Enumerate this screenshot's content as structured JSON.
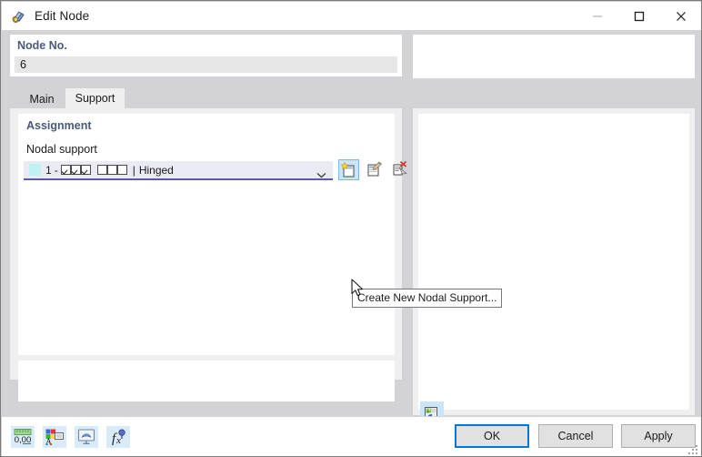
{
  "window": {
    "title": "Edit Node",
    "icon": "node-icon",
    "controls": {
      "minimize": "minimize-icon",
      "maximize": "maximize-icon",
      "close": "close-icon"
    }
  },
  "node_no": {
    "label": "Node No.",
    "value": "6",
    "placeholder": ""
  },
  "tabs": [
    {
      "id": "main",
      "label": "Main",
      "active": false
    },
    {
      "id": "support",
      "label": "Support",
      "active": true
    }
  ],
  "assignment": {
    "title": "Assignment",
    "field_label": "Nodal support",
    "combo": {
      "swatch_color": "#bff3f3",
      "number": "1",
      "separator": "-",
      "checks_on": 3,
      "checks_off": 3,
      "divider": "|",
      "name": "Hinged",
      "full_text": "1 - ☑☑☑ ☐☐☐ | Hinged"
    },
    "buttons": [
      {
        "id": "new",
        "name": "create-new-nodal-support-button",
        "tooltip": "Create New Nodal Support...",
        "hovered": true
      },
      {
        "id": "edit",
        "name": "edit-nodal-support-button",
        "tooltip": "",
        "hovered": false
      },
      {
        "id": "delete",
        "name": "delete-nodal-support-button",
        "tooltip": "",
        "hovered": false
      }
    ]
  },
  "tooltip": {
    "text": "Create New Nodal Support..."
  },
  "right_panel": {
    "render_icon": "render-preview-icon"
  },
  "footer": {
    "icons": [
      {
        "id": "decimals",
        "name": "decimal-places-icon",
        "label": "0,00"
      },
      {
        "id": "display",
        "name": "display-properties-icon",
        "label": ""
      },
      {
        "id": "view",
        "name": "view-settings-icon",
        "label": ""
      },
      {
        "id": "formula",
        "name": "formula-editor-icon",
        "label": ""
      }
    ],
    "buttons": {
      "ok": "OK",
      "cancel": "Cancel",
      "apply": "Apply"
    }
  },
  "colors": {
    "accent": "#0078d7",
    "header_text": "#4a5a7a",
    "combo_bg": "#eaeaf4",
    "combo_underline": "#5b5ba8",
    "swatch": "#bff3f3",
    "panel_bg": "#d2d2d7",
    "inner_bg": "#efeff0",
    "hover_bg": "#cce4f7"
  }
}
